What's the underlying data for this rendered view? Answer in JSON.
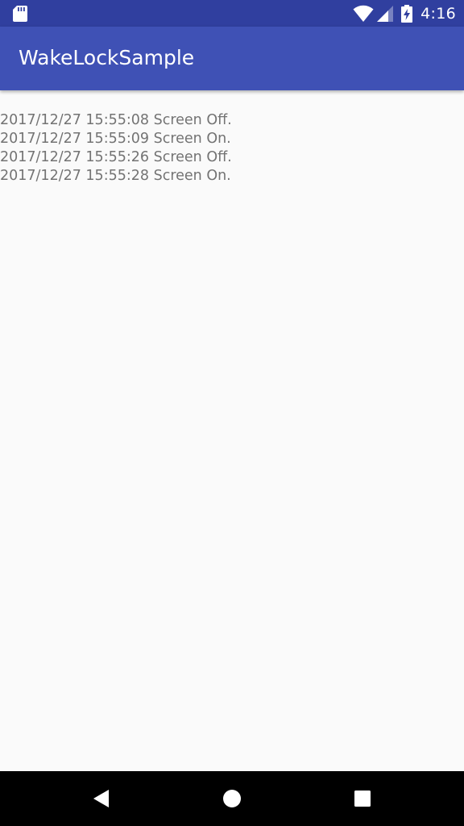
{
  "status_bar": {
    "time": "4:16",
    "icons": [
      "sd-card-icon",
      "wifi-icon",
      "cell-signal-icon",
      "battery-charging-icon"
    ]
  },
  "app_bar": {
    "title": "WakeLockSample"
  },
  "log": {
    "entries": [
      "2017/12/27 15:55:08 Screen Off.",
      "2017/12/27 15:55:09 Screen On.",
      "2017/12/27 15:55:26 Screen Off.",
      "2017/12/27 15:55:28 Screen On."
    ]
  },
  "nav_bar": {
    "icons": [
      "back-icon",
      "home-icon",
      "recents-icon"
    ]
  },
  "colors": {
    "status_bar": "#303f9f",
    "app_bar": "#3f51b5",
    "background": "#fafafa",
    "log_text": "#737373",
    "nav_bar": "#000000"
  }
}
